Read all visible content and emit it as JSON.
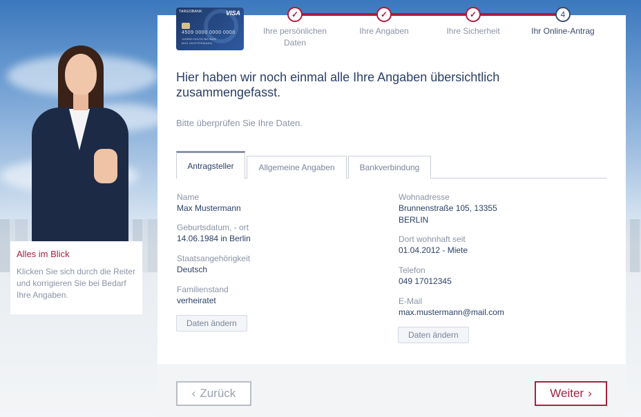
{
  "sidebar": {
    "title": "Alles im Blick",
    "text": "Klicken Sie sich durch die Reiter und korrigieren Sie bei Bedarf Ihre Angaben."
  },
  "card": {
    "brand": "TARGOBANK",
    "network": "VISA",
    "number": "4509 0000 0000 0000",
    "validity": "12/00/00   GÜLTIG BIS 00/00",
    "holder": "MAX MUSTERMANN"
  },
  "steps": [
    {
      "label": "Ihre persönlichen Daten",
      "status": "done",
      "icon": "check-icon"
    },
    {
      "label": "Ihre Angaben",
      "status": "done",
      "icon": "check-icon"
    },
    {
      "label": "Ihre Sicherheit",
      "status": "done",
      "icon": "check-icon"
    },
    {
      "label": "Ihr Online-Antrag",
      "status": "current",
      "number": "4"
    }
  ],
  "main": {
    "heading": "Hier haben wir noch einmal alle Ihre Angaben übersichtlich zusammengefasst.",
    "subheading": "Bitte überprüfen Sie Ihre Daten.",
    "tabs": [
      {
        "label": "Antragsteller",
        "active": true
      },
      {
        "label": "Allgemeine Angaben",
        "active": false
      },
      {
        "label": "Bankverbindung",
        "active": false
      }
    ],
    "left_fields": [
      {
        "label": "Name",
        "value": "Max Mustermann"
      },
      {
        "label": "Geburtsdatum, - ort",
        "value": "14.06.1984 in Berlin"
      },
      {
        "label": "Staatsangehörigkeit",
        "value": "Deutsch"
      },
      {
        "label": "Familienstand",
        "value": "verheiratet"
      }
    ],
    "right_fields": [
      {
        "label": "Wohnadresse",
        "value": "Brunnenstraße 105, 13355",
        "value2": "BERLIN"
      },
      {
        "label": "Dort wohnhaft seit",
        "value": "01.04.2012 - Miete"
      },
      {
        "label": "Telefon",
        "value": "049 17012345"
      },
      {
        "label": "E-Mail",
        "value": "max.mustermann@mail.com"
      }
    ],
    "edit_label": "Daten ändern"
  },
  "nav": {
    "back_label": "Zurück",
    "next_label": "Weiter"
  },
  "colors": {
    "accent": "#b0193c",
    "text": "#2a3e66",
    "muted": "#8a93a5"
  }
}
